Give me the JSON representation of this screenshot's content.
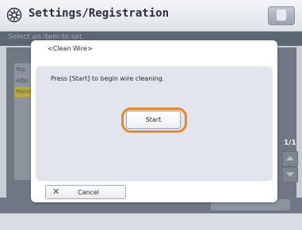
{
  "header": {
    "title": "Settings/Registration",
    "settings_icon": "gear-icon",
    "corner_button_icon": "document-icon"
  },
  "background": {
    "instruction": "Select an item to set.",
    "list_items": [
      "Top",
      "Adju",
      "Maint"
    ],
    "page_indicator": "1/1"
  },
  "dialog": {
    "title": "<Clean Wire>",
    "message": "Press [Start] to begin wire cleaning.",
    "start_label": "Start",
    "cancel_label": "Cancel",
    "cancel_icon": "close-icon"
  },
  "colors": {
    "highlight_ring": "#e8892d",
    "dialog_panel": "#e2e6ec",
    "dim_background": "#6f7884"
  }
}
